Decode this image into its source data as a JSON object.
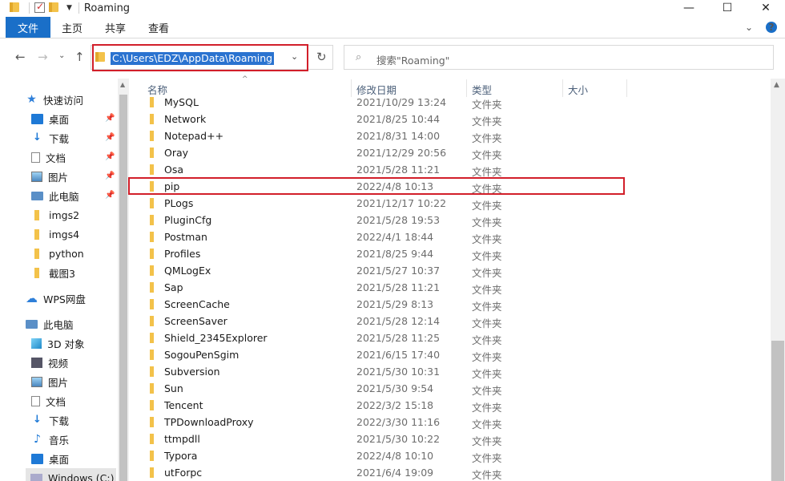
{
  "window": {
    "title": "Roaming",
    "controls": [
      "—",
      "☐",
      "✕"
    ]
  },
  "ribbon": {
    "tabs": [
      "文件",
      "主页",
      "共享",
      "查看"
    ],
    "expand": "⌄",
    "help": "?"
  },
  "nav": {
    "back": "←",
    "forward": "→",
    "recent": "⌄",
    "up": "↑",
    "refresh": "↻"
  },
  "address": {
    "path": "C:\\Users\\EDZ\\AppData\\Roaming",
    "dropdown": "⌄"
  },
  "search": {
    "placeholder": "搜索\"Roaming\"",
    "icon": "⌕"
  },
  "sidebar": {
    "quick_access": "快速访问",
    "items": [
      {
        "label": "桌面",
        "icon": "desktop-icon",
        "pinned": true
      },
      {
        "label": "下载",
        "icon": "download-icon",
        "pinned": true
      },
      {
        "label": "文档",
        "icon": "document-icon",
        "pinned": true
      },
      {
        "label": "图片",
        "icon": "picture-icon",
        "pinned": true
      },
      {
        "label": "此电脑",
        "icon": "computer-icon",
        "pinned": true
      },
      {
        "label": "imgs2",
        "icon": "folder-icon"
      },
      {
        "label": "imgs4",
        "icon": "folder-icon"
      },
      {
        "label": "python",
        "icon": "folder-icon"
      },
      {
        "label": "截图3",
        "icon": "folder-icon"
      }
    ],
    "wps": "WPS网盘",
    "this_pc": "此电脑",
    "pc_items": [
      {
        "label": "3D 对象",
        "icon": "3d-objects-icon"
      },
      {
        "label": "视频",
        "icon": "video-icon"
      },
      {
        "label": "图片",
        "icon": "picture-icon"
      },
      {
        "label": "文档",
        "icon": "document-icon"
      },
      {
        "label": "下载",
        "icon": "download-icon"
      },
      {
        "label": "音乐",
        "icon": "music-icon"
      },
      {
        "label": "桌面",
        "icon": "desktop-icon"
      },
      {
        "label": "Windows (C:)",
        "icon": "drive-icon"
      }
    ]
  },
  "columns": {
    "name": "名称",
    "date": "修改日期",
    "type": "类型",
    "size": "大小"
  },
  "files": [
    {
      "name": "MySQL",
      "date": "2021/10/29 13:24",
      "type": "文件夹"
    },
    {
      "name": "Network",
      "date": "2021/8/25 10:44",
      "type": "文件夹"
    },
    {
      "name": "Notepad++",
      "date": "2021/8/31 14:00",
      "type": "文件夹"
    },
    {
      "name": "Oray",
      "date": "2021/12/29 20:56",
      "type": "文件夹"
    },
    {
      "name": "Osa",
      "date": "2021/5/28 11:21",
      "type": "文件夹"
    },
    {
      "name": "pip",
      "date": "2022/4/8 10:13",
      "type": "文件夹"
    },
    {
      "name": "PLogs",
      "date": "2021/12/17 10:22",
      "type": "文件夹"
    },
    {
      "name": "PluginCfg",
      "date": "2021/5/28 19:53",
      "type": "文件夹"
    },
    {
      "name": "Postman",
      "date": "2022/4/1 18:44",
      "type": "文件夹"
    },
    {
      "name": "Profiles",
      "date": "2021/8/25 9:44",
      "type": "文件夹"
    },
    {
      "name": "QMLogEx",
      "date": "2021/5/27 10:37",
      "type": "文件夹"
    },
    {
      "name": "Sap",
      "date": "2021/5/28 11:21",
      "type": "文件夹"
    },
    {
      "name": "ScreenCache",
      "date": "2021/5/29 8:13",
      "type": "文件夹"
    },
    {
      "name": "ScreenSaver",
      "date": "2021/5/28 12:14",
      "type": "文件夹"
    },
    {
      "name": "Shield_2345Explorer",
      "date": "2021/5/28 11:25",
      "type": "文件夹"
    },
    {
      "name": "SogouPenSgim",
      "date": "2021/6/15 17:40",
      "type": "文件夹"
    },
    {
      "name": "Subversion",
      "date": "2021/5/30 10:31",
      "type": "文件夹"
    },
    {
      "name": "Sun",
      "date": "2021/5/30 9:54",
      "type": "文件夹"
    },
    {
      "name": "Tencent",
      "date": "2022/3/2 15:18",
      "type": "文件夹"
    },
    {
      "name": "TPDownloadProxy",
      "date": "2022/3/30 11:16",
      "type": "文件夹"
    },
    {
      "name": "ttmpdll",
      "date": "2021/5/30 10:22",
      "type": "文件夹"
    },
    {
      "name": "Typora",
      "date": "2022/4/8 10:10",
      "type": "文件夹"
    },
    {
      "name": "utForpc",
      "date": "2021/6/4 19:09",
      "type": "文件夹"
    }
  ],
  "colors": {
    "accent": "#1a6fc8",
    "highlight_border": "#d21f2a",
    "folder": "#f3c24a"
  }
}
